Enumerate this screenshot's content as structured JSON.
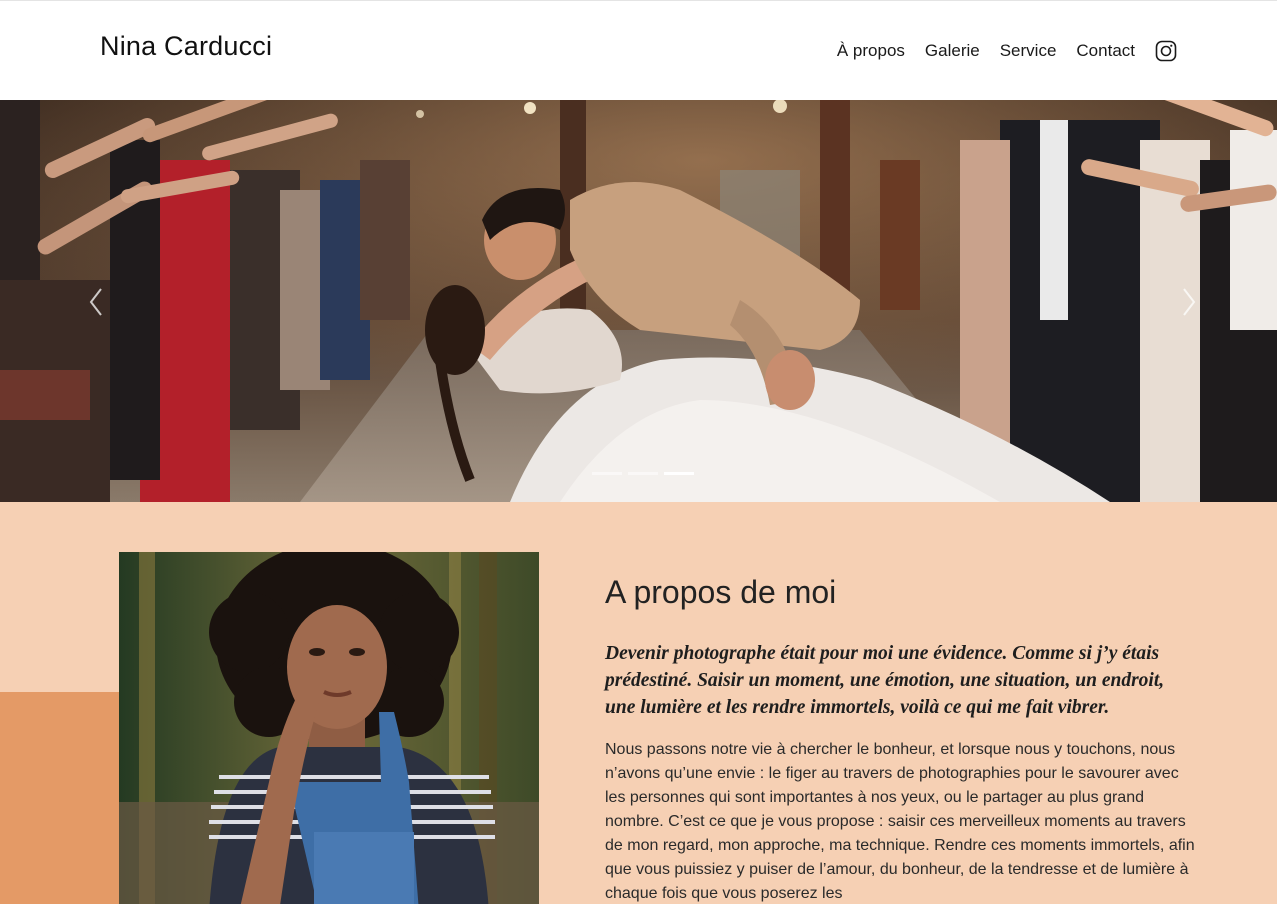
{
  "header": {
    "brand": "Nina Carducci",
    "nav": [
      {
        "label": "À propos"
      },
      {
        "label": "Galerie"
      },
      {
        "label": "Service"
      },
      {
        "label": "Contact"
      }
    ],
    "social_icon": "instagram-icon"
  },
  "hero": {
    "image_alt": "Wedding couple kissing",
    "prev_icon": "chevron-left-icon",
    "next_icon": "chevron-right-icon",
    "slides_count": 3,
    "active_slide": 3
  },
  "about": {
    "title": "A propos de moi",
    "lead": "Devenir photographe était pour moi une évidence. Comme si j’y étais prédestiné. Saisir un moment, une émotion, une situation, un endroit, une lumière et les rendre immortels, voilà ce qui me fait vibrer.",
    "body": "Nous passons notre vie à chercher le bonheur, et lorsque nous y touchons, nous n’avons qu’une envie : le figer au travers de photographies pour le savourer avec les personnes qui sont importantes à nos yeux, ou le partager au plus grand nombre. C’est ce que je vous propose : saisir ces merveilleux moments au travers de mon regard, mon approche, ma technique. Rendre ces moments immortels, afin que vous puissiez y puiser de l’amour, du bonheur, de la tendresse et de lumière à chaque fois que vous poserez les",
    "portrait_alt": "Portrait of Nina Carducci"
  },
  "colors": {
    "about_bg": "#f6d0b4",
    "accent": "#e49a66",
    "text": "#1c1c1c"
  }
}
